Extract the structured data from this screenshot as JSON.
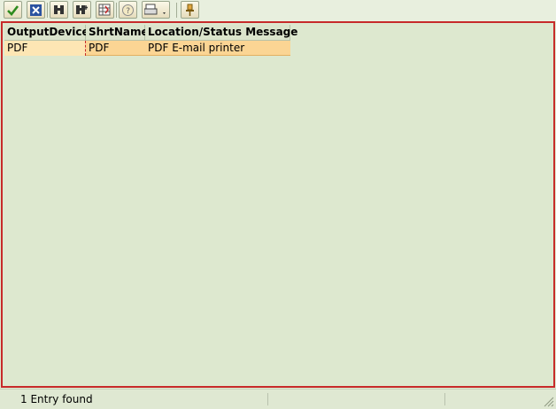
{
  "toolbar": {
    "buttons": [
      {
        "name": "continue-button",
        "icon": "checkmark-icon",
        "color": "#2e8b1e"
      },
      {
        "name": "cancel-button",
        "icon": "close-x-icon",
        "color": "#2a52a0"
      },
      {
        "name": "find-button",
        "icon": "binoculars-icon"
      },
      {
        "name": "find-next-button",
        "icon": "binoculars-plus-icon"
      },
      {
        "name": "sort-button",
        "icon": "sort-grid-icon"
      },
      {
        "name": "info-button",
        "icon": "info-icon"
      },
      {
        "name": "print-button",
        "icon": "printer-icon"
      },
      {
        "name": "hold-selection-button",
        "icon": "pin-icon"
      }
    ]
  },
  "table": {
    "columns": [
      "OutputDevice",
      "ShrtName",
      "Location/Status Message"
    ],
    "rows": [
      [
        "PDF",
        "PDF",
        "PDF E-mail printer"
      ]
    ]
  },
  "status": {
    "message": "1 Entry found"
  },
  "colors": {
    "frame_border": "#c72a2a",
    "background": "#dde8cf",
    "selected_row": "#fbd594"
  }
}
